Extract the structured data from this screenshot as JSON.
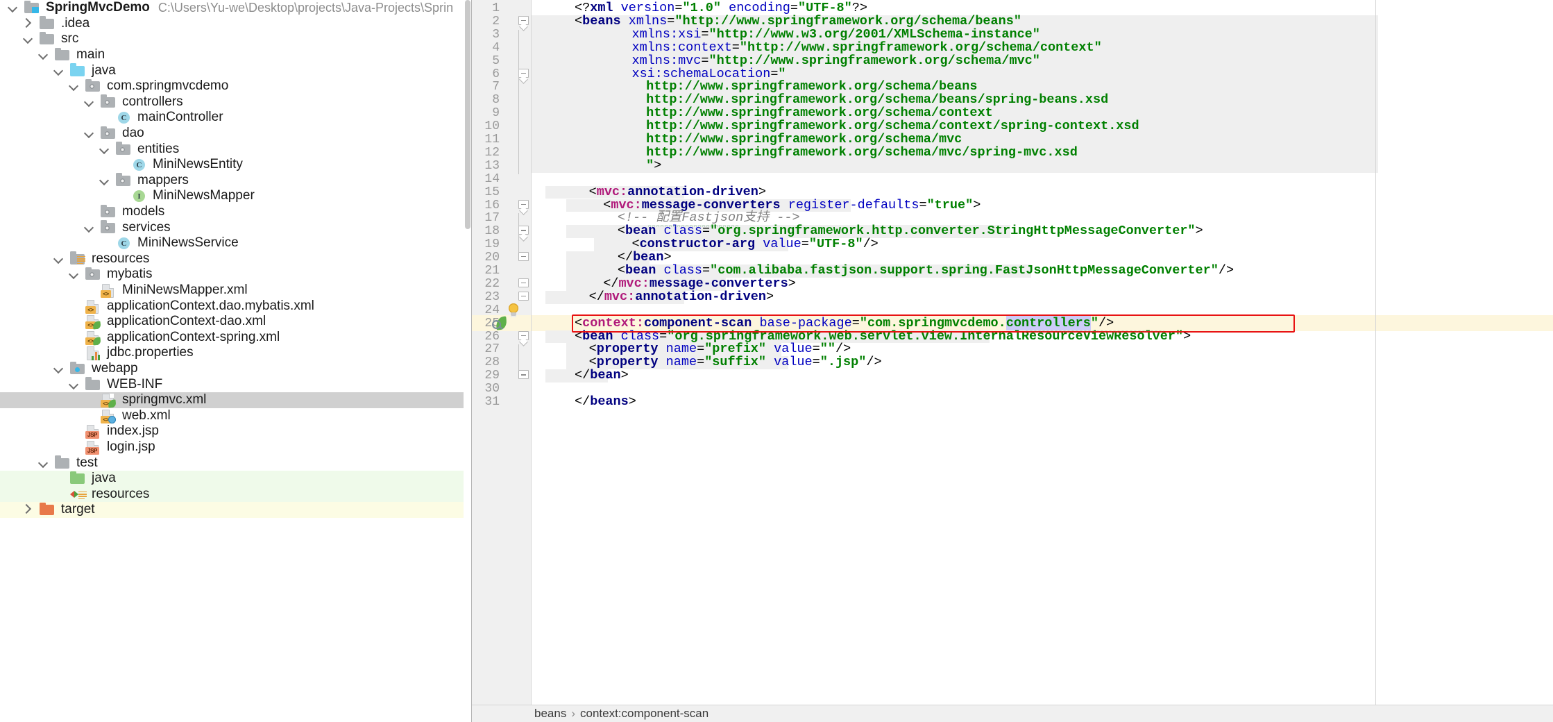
{
  "project": {
    "name": "SpringMvcDemo",
    "path": "C:\\Users\\Yu-we\\Desktop\\projects\\Java-Projects\\Sprin",
    "tree": [
      {
        "label": "SpringMvcDemo",
        "icon": "module-icon",
        "indent": 0,
        "arrow": "down",
        "style": "bold",
        "bg": "none"
      },
      {
        "label": ".idea",
        "icon": "folder-gray-icon",
        "indent": 1,
        "arrow": "right",
        "style": "",
        "bg": "none"
      },
      {
        "label": "src",
        "icon": "folder-gray-icon",
        "indent": 1,
        "arrow": "down",
        "style": "",
        "bg": "none"
      },
      {
        "label": "main",
        "icon": "folder-gray-icon",
        "indent": 2,
        "arrow": "down",
        "style": "",
        "bg": "none"
      },
      {
        "label": "java",
        "icon": "source-root-icon",
        "indent": 3,
        "arrow": "down",
        "style": "",
        "bg": "none"
      },
      {
        "label": "com.springmvcdemo",
        "icon": "package-icon",
        "indent": 4,
        "arrow": "down",
        "style": "",
        "bg": "none"
      },
      {
        "label": "controllers",
        "icon": "package-icon",
        "indent": 5,
        "arrow": "down",
        "style": "",
        "bg": "none"
      },
      {
        "label": "mainController",
        "icon": "java-class-icon",
        "indent": 6,
        "arrow": "none",
        "style": "",
        "bg": "none"
      },
      {
        "label": "dao",
        "icon": "package-icon",
        "indent": 5,
        "arrow": "down",
        "style": "",
        "bg": "none"
      },
      {
        "label": "entities",
        "icon": "package-icon",
        "indent": 6,
        "arrow": "down",
        "style": "",
        "bg": "none"
      },
      {
        "label": "MiniNewsEntity",
        "icon": "java-class-icon",
        "indent": 7,
        "arrow": "none",
        "style": "",
        "bg": "none"
      },
      {
        "label": "mappers",
        "icon": "package-icon",
        "indent": 6,
        "arrow": "down",
        "style": "",
        "bg": "none"
      },
      {
        "label": "MiniNewsMapper",
        "icon": "java-interface-icon",
        "indent": 7,
        "arrow": "none",
        "style": "",
        "bg": "none"
      },
      {
        "label": "models",
        "icon": "package-icon",
        "indent": 5,
        "arrow": "none",
        "style": "",
        "bg": "none"
      },
      {
        "label": "services",
        "icon": "package-icon",
        "indent": 5,
        "arrow": "down",
        "style": "",
        "bg": "none"
      },
      {
        "label": "MiniNewsService",
        "icon": "java-class-icon",
        "indent": 6,
        "arrow": "none",
        "style": "",
        "bg": "none"
      },
      {
        "label": "resources",
        "icon": "resource-root-icon",
        "indent": 3,
        "arrow": "down",
        "style": "",
        "bg": "none"
      },
      {
        "label": "mybatis",
        "icon": "package-icon",
        "indent": 4,
        "arrow": "down",
        "style": "",
        "bg": "none"
      },
      {
        "label": "MiniNewsMapper.xml",
        "icon": "xml-file-icon",
        "indent": 5,
        "arrow": "none",
        "style": "",
        "bg": "none"
      },
      {
        "label": "applicationContext.dao.mybatis.xml",
        "icon": "xml-file-icon",
        "indent": 4,
        "arrow": "none",
        "style": "",
        "bg": "none"
      },
      {
        "label": "applicationContext-dao.xml",
        "icon": "spring-xml-file-icon",
        "indent": 4,
        "arrow": "none",
        "style": "",
        "bg": "none"
      },
      {
        "label": "applicationContext-spring.xml",
        "icon": "spring-xml-file-icon",
        "indent": 4,
        "arrow": "none",
        "style": "",
        "bg": "none"
      },
      {
        "label": "jdbc.properties",
        "icon": "properties-file-icon",
        "indent": 4,
        "arrow": "none",
        "style": "",
        "bg": "none"
      },
      {
        "label": "webapp",
        "icon": "web-root-icon",
        "indent": 3,
        "arrow": "down",
        "style": "",
        "bg": "none"
      },
      {
        "label": "WEB-INF",
        "icon": "folder-gray-icon",
        "indent": 4,
        "arrow": "down",
        "style": "",
        "bg": "none"
      },
      {
        "label": "springmvc.xml",
        "icon": "spring-xml-file-icon",
        "indent": 5,
        "arrow": "none",
        "style": "",
        "bg": "selected"
      },
      {
        "label": "web.xml",
        "icon": "web-xml-file-icon",
        "indent": 5,
        "arrow": "none",
        "style": "",
        "bg": "none"
      },
      {
        "label": "index.jsp",
        "icon": "jsp-file-icon",
        "indent": 4,
        "arrow": "none",
        "style": "",
        "bg": "none"
      },
      {
        "label": "login.jsp",
        "icon": "jsp-file-icon",
        "indent": 4,
        "arrow": "none",
        "style": "",
        "bg": "none"
      },
      {
        "label": "test",
        "icon": "folder-gray-icon",
        "indent": 2,
        "arrow": "down",
        "style": "",
        "bg": "none"
      },
      {
        "label": "java",
        "icon": "test-source-icon",
        "indent": 3,
        "arrow": "none",
        "style": "",
        "bg": "green"
      },
      {
        "label": "resources",
        "icon": "test-resource-icon",
        "indent": 3,
        "arrow": "none",
        "style": "",
        "bg": "green"
      },
      {
        "label": "target",
        "icon": "folder-orange-icon",
        "indent": 1,
        "arrow": "right",
        "style": "",
        "bg": "yellow"
      }
    ]
  },
  "editor": {
    "breadcrumb": [
      "beans",
      "context:component-scan"
    ],
    "breadcrumb_separator": "›",
    "annotation": {
      "type": "red-rectangle",
      "line": 25,
      "color": "#e81313"
    },
    "gutter_icons": [
      {
        "line": 24,
        "icon": "lightbulb-icon"
      },
      {
        "line": 25,
        "icon": "spring-bean-icon"
      }
    ],
    "selected_token": "controllers",
    "lines": [
      {
        "n": 1,
        "indent": 0,
        "tokens": [
          {
            "t": "&lt;?",
            "c": "t-punct"
          },
          {
            "t": "xml",
            "c": "t-proc"
          },
          {
            "t": " ",
            "c": "t-punct"
          },
          {
            "t": "version",
            "c": "t-attr"
          },
          {
            "t": "=",
            "c": "t-punct"
          },
          {
            "t": "\"1.0\"",
            "c": "t-val"
          },
          {
            "t": " ",
            "c": "t-punct"
          },
          {
            "t": "encoding",
            "c": "t-attr"
          },
          {
            "t": "=",
            "c": "t-punct"
          },
          {
            "t": "\"UTF-8\"",
            "c": "t-val"
          },
          {
            "t": "?&gt;",
            "c": "t-punct"
          }
        ]
      },
      {
        "n": 2,
        "indent": 0,
        "tokens": [
          {
            "t": "&lt;",
            "c": "t-punct"
          },
          {
            "t": "beans",
            "c": "t-tag"
          },
          {
            "t": " ",
            "c": "t-punct"
          },
          {
            "t": "xmlns",
            "c": "t-attr"
          },
          {
            "t": "=",
            "c": "t-punct"
          },
          {
            "t": "\"http://www.springframework.org/schema/beans\"",
            "c": "t-val"
          }
        ]
      },
      {
        "n": 3,
        "indent": 4,
        "tokens": [
          {
            "t": "xmlns:xsi",
            "c": "t-attr"
          },
          {
            "t": "=",
            "c": "t-punct"
          },
          {
            "t": "\"http://www.w3.org/2001/XMLSchema-instance\"",
            "c": "t-val"
          }
        ]
      },
      {
        "n": 4,
        "indent": 4,
        "tokens": [
          {
            "t": "xmlns:context",
            "c": "t-attr"
          },
          {
            "t": "=",
            "c": "t-punct"
          },
          {
            "t": "\"http://www.springframework.org/schema/context\"",
            "c": "t-val"
          }
        ]
      },
      {
        "n": 5,
        "indent": 4,
        "tokens": [
          {
            "t": "xmlns:mvc",
            "c": "t-attr"
          },
          {
            "t": "=",
            "c": "t-punct"
          },
          {
            "t": "\"http://www.springframework.org/schema/mvc\"",
            "c": "t-val"
          }
        ]
      },
      {
        "n": 6,
        "indent": 4,
        "tokens": [
          {
            "t": "xsi:schemaLocation",
            "c": "t-attr"
          },
          {
            "t": "=",
            "c": "t-punct"
          },
          {
            "t": "\"",
            "c": "t-val"
          }
        ]
      },
      {
        "n": 7,
        "indent": 5,
        "tokens": [
          {
            "t": "http://www.springframework.org/schema/beans",
            "c": "t-val"
          }
        ]
      },
      {
        "n": 8,
        "indent": 5,
        "tokens": [
          {
            "t": "http://www.springframework.org/schema/beans/spring-beans.xsd",
            "c": "t-val"
          }
        ]
      },
      {
        "n": 9,
        "indent": 5,
        "tokens": [
          {
            "t": "http://www.springframework.org/schema/context",
            "c": "t-val"
          }
        ]
      },
      {
        "n": 10,
        "indent": 5,
        "tokens": [
          {
            "t": "http://www.springframework.org/schema/context/spring-context.xsd",
            "c": "t-val"
          }
        ]
      },
      {
        "n": 11,
        "indent": 5,
        "tokens": [
          {
            "t": "http://www.springframework.org/schema/mvc",
            "c": "t-val"
          }
        ]
      },
      {
        "n": 12,
        "indent": 5,
        "tokens": [
          {
            "t": "http://www.springframework.org/schema/mvc/spring-mvc.xsd",
            "c": "t-val"
          }
        ]
      },
      {
        "n": 13,
        "indent": 5,
        "tokens": [
          {
            "t": "\"",
            "c": "t-val"
          },
          {
            "t": "&gt;",
            "c": "t-punct"
          }
        ]
      },
      {
        "n": 14,
        "indent": 0,
        "tokens": []
      },
      {
        "n": 15,
        "indent": 1,
        "tokens": [
          {
            "t": "&lt;",
            "c": "t-punct"
          },
          {
            "t": "mvc:",
            "c": "t-ns"
          },
          {
            "t": "annotation-driven",
            "c": "t-tag"
          },
          {
            "t": "&gt;",
            "c": "t-punct"
          }
        ]
      },
      {
        "n": 16,
        "indent": 2,
        "tokens": [
          {
            "t": "&lt;",
            "c": "t-punct"
          },
          {
            "t": "mvc:",
            "c": "t-ns"
          },
          {
            "t": "message-converters",
            "c": "t-tag"
          },
          {
            "t": " ",
            "c": "t-punct"
          },
          {
            "t": "register-defaults",
            "c": "t-attr"
          },
          {
            "t": "=",
            "c": "t-punct"
          },
          {
            "t": "\"true\"",
            "c": "t-val"
          },
          {
            "t": "&gt;",
            "c": "t-punct"
          }
        ]
      },
      {
        "n": 17,
        "indent": 3,
        "tokens": [
          {
            "t": "&lt;!-- 配置Fastjson支持 --&gt;",
            "c": "t-cmt"
          }
        ]
      },
      {
        "n": 18,
        "indent": 3,
        "tokens": [
          {
            "t": "&lt;",
            "c": "t-punct"
          },
          {
            "t": "bean",
            "c": "t-tag"
          },
          {
            "t": " ",
            "c": "t-punct"
          },
          {
            "t": "class",
            "c": "t-attr"
          },
          {
            "t": "=",
            "c": "t-punct"
          },
          {
            "t": "\"org.springframework.http.converter.StringHttpMessageConverter\"",
            "c": "t-val"
          },
          {
            "t": "&gt;",
            "c": "t-punct"
          }
        ]
      },
      {
        "n": 19,
        "indent": 4,
        "tokens": [
          {
            "t": "&lt;",
            "c": "t-punct"
          },
          {
            "t": "constructor-arg",
            "c": "t-tag"
          },
          {
            "t": " ",
            "c": "t-punct"
          },
          {
            "t": "value",
            "c": "t-attr"
          },
          {
            "t": "=",
            "c": "t-punct"
          },
          {
            "t": "\"UTF-8\"",
            "c": "t-val"
          },
          {
            "t": "/&gt;",
            "c": "t-punct"
          }
        ]
      },
      {
        "n": 20,
        "indent": 3,
        "tokens": [
          {
            "t": "&lt;/",
            "c": "t-punct"
          },
          {
            "t": "bean",
            "c": "t-tag"
          },
          {
            "t": "&gt;",
            "c": "t-punct"
          }
        ]
      },
      {
        "n": 21,
        "indent": 3,
        "tokens": [
          {
            "t": "&lt;",
            "c": "t-punct"
          },
          {
            "t": "bean",
            "c": "t-tag"
          },
          {
            "t": " ",
            "c": "t-punct"
          },
          {
            "t": "class",
            "c": "t-attr"
          },
          {
            "t": "=",
            "c": "t-punct"
          },
          {
            "t": "\"com.alibaba.fastjson.support.spring.FastJsonHttpMessageConverter\"",
            "c": "t-val"
          },
          {
            "t": "/&gt;",
            "c": "t-punct"
          }
        ]
      },
      {
        "n": 22,
        "indent": 2,
        "tokens": [
          {
            "t": "&lt;/",
            "c": "t-punct"
          },
          {
            "t": "mvc:",
            "c": "t-ns"
          },
          {
            "t": "message-converters",
            "c": "t-tag"
          },
          {
            "t": "&gt;",
            "c": "t-punct"
          }
        ]
      },
      {
        "n": 23,
        "indent": 1,
        "tokens": [
          {
            "t": "&lt;/",
            "c": "t-punct"
          },
          {
            "t": "mvc:",
            "c": "t-ns"
          },
          {
            "t": "annotation-driven",
            "c": "t-tag"
          },
          {
            "t": "&gt;",
            "c": "t-punct"
          }
        ]
      },
      {
        "n": 24,
        "indent": 0,
        "tokens": []
      },
      {
        "n": 25,
        "indent": 0,
        "tokens": [
          {
            "t": "&lt;",
            "c": "t-punct"
          },
          {
            "t": "context:",
            "c": "t-ns"
          },
          {
            "t": "component-scan",
            "c": "t-tag"
          },
          {
            "t": " ",
            "c": "t-punct"
          },
          {
            "t": "base-package",
            "c": "t-attr"
          },
          {
            "t": "=",
            "c": "t-punct"
          },
          {
            "t": "\"com.springmvcdemo.",
            "c": "t-val"
          },
          {
            "t": "controllers",
            "c": "t-val sel-token"
          },
          {
            "t": "\"",
            "c": "t-val"
          },
          {
            "t": "/&gt;",
            "c": "t-punct"
          }
        ]
      },
      {
        "n": 26,
        "indent": 0,
        "tokens": [
          {
            "t": "&lt;",
            "c": "t-punct"
          },
          {
            "t": "bean",
            "c": "t-tag"
          },
          {
            "t": " ",
            "c": "t-punct"
          },
          {
            "t": "class",
            "c": "t-attr"
          },
          {
            "t": "=",
            "c": "t-punct"
          },
          {
            "t": "\"org.springframework.web.servlet.view.InternalResourceViewResolver\"",
            "c": "t-val"
          },
          {
            "t": "&gt;",
            "c": "t-punct"
          }
        ]
      },
      {
        "n": 27,
        "indent": 1,
        "tokens": [
          {
            "t": "&lt;",
            "c": "t-punct"
          },
          {
            "t": "property",
            "c": "t-tag"
          },
          {
            "t": " ",
            "c": "t-punct"
          },
          {
            "t": "name",
            "c": "t-attr"
          },
          {
            "t": "=",
            "c": "t-punct"
          },
          {
            "t": "\"prefix\"",
            "c": "t-val"
          },
          {
            "t": " ",
            "c": "t-punct"
          },
          {
            "t": "value",
            "c": "t-attr"
          },
          {
            "t": "=",
            "c": "t-punct"
          },
          {
            "t": "\"\"",
            "c": "t-val"
          },
          {
            "t": "/&gt;",
            "c": "t-punct"
          }
        ]
      },
      {
        "n": 28,
        "indent": 1,
        "tokens": [
          {
            "t": "&lt;",
            "c": "t-punct"
          },
          {
            "t": "property",
            "c": "t-tag"
          },
          {
            "t": " ",
            "c": "t-punct"
          },
          {
            "t": "name",
            "c": "t-attr"
          },
          {
            "t": "=",
            "c": "t-punct"
          },
          {
            "t": "\"suffix\"",
            "c": "t-val"
          },
          {
            "t": " ",
            "c": "t-punct"
          },
          {
            "t": "value",
            "c": "t-attr"
          },
          {
            "t": "=",
            "c": "t-punct"
          },
          {
            "t": "\".jsp\"",
            "c": "t-val"
          },
          {
            "t": "/&gt;",
            "c": "t-punct"
          }
        ]
      },
      {
        "n": 29,
        "indent": 0,
        "tokens": [
          {
            "t": "&lt;/",
            "c": "t-punct"
          },
          {
            "t": "bean",
            "c": "t-tag"
          },
          {
            "t": "&gt;",
            "c": "t-punct"
          }
        ]
      },
      {
        "n": 30,
        "indent": 0,
        "tokens": []
      },
      {
        "n": 31,
        "indent": 0,
        "tokens": [
          {
            "t": "&lt;/",
            "c": "t-punct"
          },
          {
            "t": "beans",
            "c": "t-tag"
          },
          {
            "t": "&gt;",
            "c": "t-punct"
          }
        ]
      }
    ]
  }
}
